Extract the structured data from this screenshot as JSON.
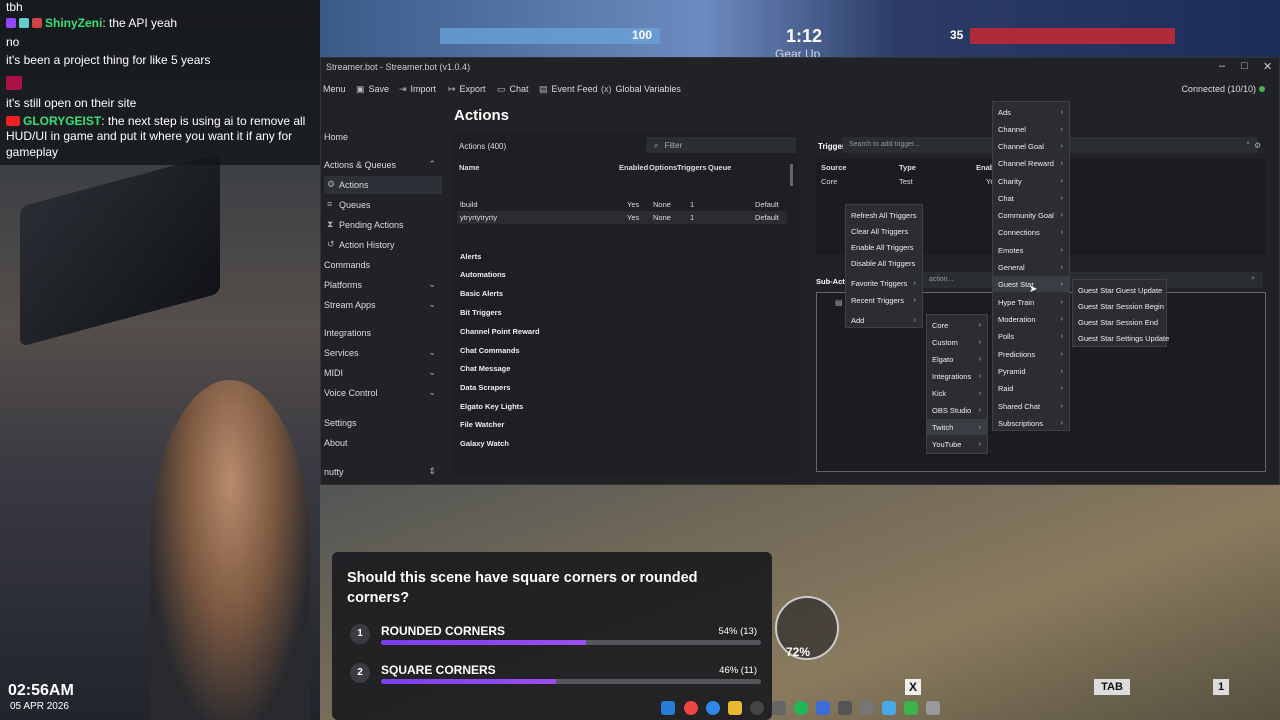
{
  "chat": {
    "lines": [
      {
        "text": "tbh"
      },
      {
        "user": "ShinyZeni",
        "text": ": the API yeah"
      },
      {
        "text": "no"
      },
      {
        "text": "it's been a project thing for like 5 years"
      },
      {
        "text": "it's still open on their site"
      },
      {
        "user": "GLORYGEIST",
        "text": ": the next step is using ai to remove all"
      },
      {
        "text": "HUD/UI in game and put it where you want it if any for"
      },
      {
        "text": "gameplay"
      }
    ]
  },
  "cam": {
    "time": "02:56AM",
    "date": "05 APR 2026"
  },
  "game_hud": {
    "left_score": "100",
    "timer": "1:12",
    "subtitle": "Gear Up",
    "right_score": "35",
    "ability_pct": "72%",
    "tab_key": "TAB",
    "one_key": "1",
    "x_key": "X"
  },
  "window": {
    "title": "Streamer.bot - Streamer.bot (v1.0.4)",
    "toolbar": [
      "Menu",
      "Save",
      "Import",
      "Export",
      "Chat",
      "Event Feed",
      "Global Variables"
    ],
    "toolbar_icons": [
      "menu-icon",
      "save-icon",
      "import-icon",
      "export-icon",
      "chat-icon",
      "event-feed-icon",
      "variables-icon"
    ],
    "connected": "Connected (10/10)"
  },
  "sidebar": [
    {
      "label": "Home",
      "sub": false
    },
    {
      "label": "Actions & Queues",
      "sub": false,
      "chev": "⌃"
    },
    {
      "label": "Actions",
      "sub": true,
      "active": true
    },
    {
      "label": "Queues",
      "sub": true
    },
    {
      "label": "Pending Actions",
      "sub": true
    },
    {
      "label": "Action History",
      "sub": true
    },
    {
      "label": "Commands",
      "sub": false
    },
    {
      "label": "Platforms",
      "sub": false,
      "chev": "⌄"
    },
    {
      "label": "Stream Apps",
      "sub": false,
      "chev": "⌄"
    },
    {
      "label": "Integrations",
      "sub": false
    },
    {
      "label": "Services",
      "sub": false,
      "chev": "⌄"
    },
    {
      "label": "MIDI",
      "sub": false,
      "chev": "⌄"
    },
    {
      "label": "Voice Control",
      "sub": false,
      "chev": "⌄"
    },
    {
      "label": "Settings",
      "sub": false
    },
    {
      "label": "About",
      "sub": false
    },
    {
      "label": "nutty",
      "sub": false,
      "chev": "⇕"
    }
  ],
  "actions": {
    "title": "Actions",
    "header": "Actions (400)",
    "filter_placeholder": "Filter",
    "columns": [
      "Name",
      "Enabled",
      "Options",
      "Triggers",
      "Queue"
    ],
    "rows": [
      {
        "name": "lbuild",
        "enabled": "Yes",
        "options": "None",
        "triggers": "1",
        "queue": "Default"
      },
      {
        "name": "ytryrtytryrty",
        "enabled": "Yes",
        "options": "None",
        "triggers": "1",
        "queue": "Default"
      }
    ],
    "groups": [
      "Alerts",
      "Automations",
      "Basic Alerts",
      "Bit Triggers",
      "Channel Point Reward",
      "Chat Commands",
      "Chat Message",
      "Data Scrapers",
      "Elgato Key Lights",
      "File Watcher",
      "Galaxy Watch"
    ]
  },
  "triggers": {
    "title": "Triggers",
    "search_placeholder": "Search to add trigger...",
    "columns": [
      "Source",
      "Type",
      "Enabled"
    ],
    "row": {
      "source": "Core",
      "type": "Test",
      "enabled": "Yes"
    }
  },
  "subactions": {
    "title": "Sub-Actions",
    "search_placeholder": "action..."
  },
  "menus": {
    "context": [
      "Refresh All Triggers",
      "Clear All Triggers",
      "Enable All Triggers",
      "Disable All Triggers",
      "Favorite Triggers",
      "Recent Triggers",
      "Add"
    ],
    "add": [
      "Core",
      "Custom",
      "Elgato",
      "Integrations",
      "Kick",
      "OBS Studio",
      "Twitch",
      "YouTube"
    ],
    "twitch": [
      "Ads",
      "Channel",
      "Channel Goal",
      "Channel Reward",
      "Charity",
      "Chat",
      "Community Goal",
      "Connections",
      "Emotes",
      "General",
      "Guest Star",
      "Hype Train",
      "Moderation",
      "Polls",
      "Predictions",
      "Pyramid",
      "Raid",
      "Shared Chat",
      "Subscriptions"
    ],
    "guest_star": [
      "Guest Star Guest Update",
      "Guest Star Session Begin",
      "Guest Star Session End",
      "Guest Star Settings Update"
    ]
  },
  "poll": {
    "question": "Should this scene have square corners or rounded corners?",
    "options": [
      {
        "num": "1",
        "label": "ROUNDED CORNERS",
        "pct": "54% (13)",
        "value": 0.54
      },
      {
        "num": "2",
        "label": "SQUARE CORNERS",
        "pct": "46% (11)",
        "value": 0.46
      }
    ]
  }
}
